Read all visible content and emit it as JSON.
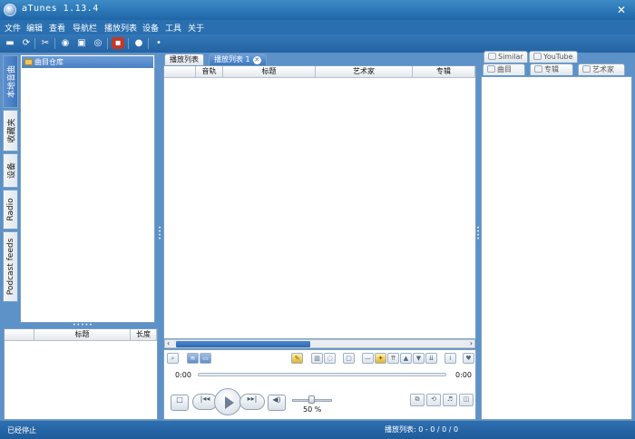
{
  "window": {
    "title": "aTunes 1.13.4",
    "close_glyph": "✕"
  },
  "menu": [
    "文件",
    "编辑",
    "查看",
    "导航栏",
    "播放列表",
    "设备",
    "工具",
    "关于"
  ],
  "toolbar": [
    "folder-open-icon",
    "refresh-icon",
    "tools-icon",
    "repository-icon",
    "device-icon",
    "radio-icon",
    "podcast-icon",
    "info-icon",
    "star-icon"
  ],
  "vertical_tabs": [
    {
      "label": "本地音曲",
      "active": true
    },
    {
      "label": "收藏夹",
      "active": false
    },
    {
      "label": "设备",
      "active": false
    },
    {
      "label": "Radio",
      "active": false
    },
    {
      "label": "Podcast feeds",
      "active": false
    }
  ],
  "navigator": {
    "root_label": "曲目仓库",
    "splitter_dots": "•••••"
  },
  "left_table": {
    "columns": [
      "",
      "标题",
      "长度"
    ]
  },
  "playlist_tabs": [
    {
      "label": "播放列表",
      "active": false
    },
    {
      "label": "播放列表 1",
      "active": true,
      "close": "✕"
    }
  ],
  "playlist_table": {
    "columns": [
      "",
      "音轨",
      "标题",
      "艺术家",
      "专辑"
    ]
  },
  "player": {
    "time_elapsed": "0:00",
    "time_total": "0:00",
    "volume_label": "50 %",
    "volume": 0.5,
    "progress": 0.0
  },
  "right_tabs_top": [
    {
      "label": "Similar",
      "icon": "similar-icon"
    },
    {
      "label": "YouTube",
      "icon": "youtube-icon"
    }
  ],
  "right_tabs_bottom": [
    {
      "label": "曲目",
      "icon": "track-icon",
      "active": true
    },
    {
      "label": "专辑",
      "icon": "album-icon",
      "active": false
    },
    {
      "label": "艺术家",
      "icon": "artist-icon",
      "active": false
    }
  ],
  "status": {
    "left": "已经停止",
    "right": "播放列表: 0 - 0 / 0 / 0"
  }
}
